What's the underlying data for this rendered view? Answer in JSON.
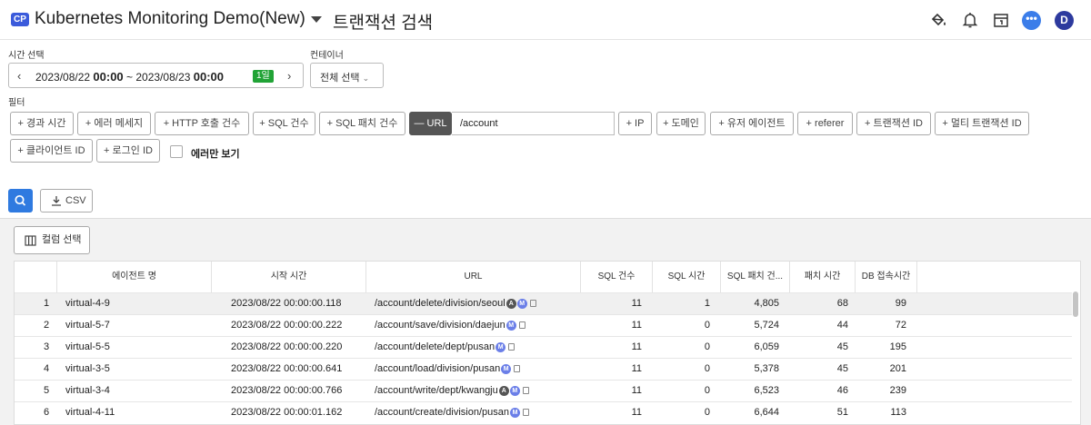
{
  "header": {
    "badge": "CP",
    "project": "Kubernetes Monitoring Demo(New)",
    "page_title": "트랜잭션 검색",
    "chat_glyph": "•••",
    "avatar_initial": "D",
    "icons": [
      "paint-bucket-icon",
      "bell-icon",
      "calendar-icon",
      "chat-icon",
      "user-avatar"
    ]
  },
  "time": {
    "label": "시간 선택",
    "start_date": "2023/08/22",
    "start_time": "00:00",
    "separator": "~",
    "end_date": "2023/08/23",
    "end_time": "00:00",
    "duration_badge": "1일"
  },
  "container": {
    "label": "컨테이너",
    "value": "전체 선택"
  },
  "filters": {
    "label": "필터",
    "chips": [
      "+ 경과 시간",
      "+ 에러 메세지",
      "+ HTTP 호출 건수",
      "+ SQL 건수",
      "+ SQL 패치 건수",
      "— URL",
      "+ IP",
      "+ 도메인",
      "+ 유저 에이전트",
      "+ referer",
      "+ 트랜잭션 ID",
      "+ 멀티 트랜잭션 ID",
      "+ 클라이언트 ID",
      "+ 로그인 ID"
    ],
    "url_value": "/account",
    "errors_only_label": "에러만 보기"
  },
  "actions": {
    "csv_label": "CSV",
    "column_select_label": "컬럼 선택"
  },
  "table": {
    "columns": [
      "에이전트 명",
      "시작 시간",
      "URL",
      "SQL 건수",
      "SQL 시간",
      "SQL 패치 건...",
      "패치 시간",
      "DB 접속시간"
    ],
    "rows": [
      {
        "no": "1",
        "agent": "virtual-4-9",
        "start": "2023/08/22 00:00:00.118",
        "url": "/account/delete/division/seoul",
        "badges": [
          "A",
          "M"
        ],
        "sql_count": "11",
        "sql_time": "1",
        "fetch_count": "4,805",
        "fetch_time": "68",
        "db_conn": "99"
      },
      {
        "no": "2",
        "agent": "virtual-5-7",
        "start": "2023/08/22 00:00:00.222",
        "url": "/account/save/division/daejun",
        "badges": [
          "M"
        ],
        "sql_count": "11",
        "sql_time": "0",
        "fetch_count": "5,724",
        "fetch_time": "44",
        "db_conn": "72"
      },
      {
        "no": "3",
        "agent": "virtual-5-5",
        "start": "2023/08/22 00:00:00.220",
        "url": "/account/delete/dept/pusan",
        "badges": [
          "M"
        ],
        "sql_count": "11",
        "sql_time": "0",
        "fetch_count": "6,059",
        "fetch_time": "45",
        "db_conn": "195"
      },
      {
        "no": "4",
        "agent": "virtual-3-5",
        "start": "2023/08/22 00:00:00.641",
        "url": "/account/load/division/pusan",
        "badges": [
          "M"
        ],
        "sql_count": "11",
        "sql_time": "0",
        "fetch_count": "5,378",
        "fetch_time": "45",
        "db_conn": "201"
      },
      {
        "no": "5",
        "agent": "virtual-3-4",
        "start": "2023/08/22 00:00:00.766",
        "url": "/account/write/dept/kwangju",
        "badges": [
          "A",
          "M"
        ],
        "sql_count": "11",
        "sql_time": "0",
        "fetch_count": "6,523",
        "fetch_time": "46",
        "db_conn": "239"
      },
      {
        "no": "6",
        "agent": "virtual-4-11",
        "start": "2023/08/22 00:00:01.162",
        "url": "/account/create/division/pusan",
        "badges": [
          "M"
        ],
        "sql_count": "11",
        "sql_time": "0",
        "fetch_count": "6,644",
        "fetch_time": "51",
        "db_conn": "113"
      }
    ]
  },
  "colors": {
    "primary": "#2f7ae0",
    "badge_green": "#21a336",
    "badge_A": "#555555",
    "badge_M": "#6b7fe8"
  }
}
